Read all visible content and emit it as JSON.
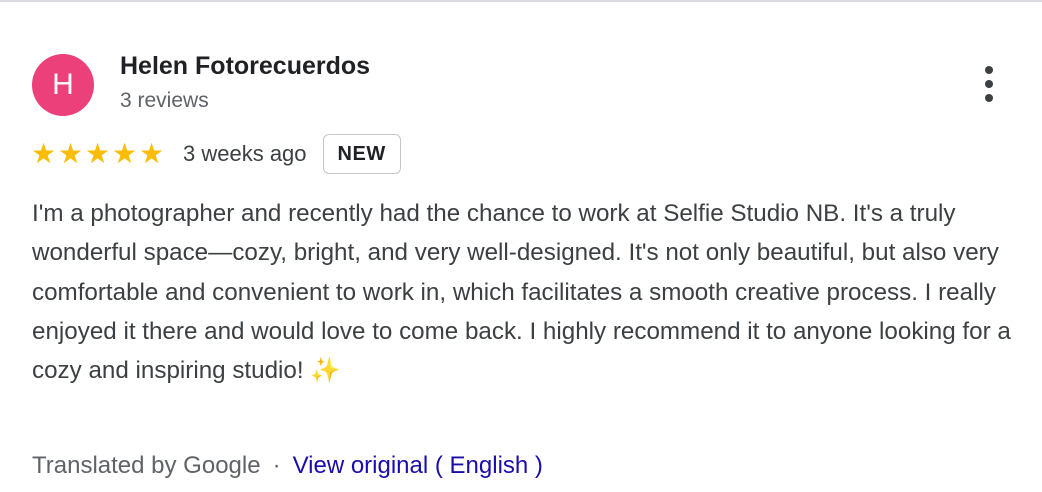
{
  "review": {
    "author_initial": "H",
    "author_name": "Helen Fotorecuerdos",
    "author_reviews": "3 reviews",
    "rating": 5,
    "rating_max": 5,
    "star_glyph": "★",
    "date": "3 weeks ago",
    "badge": "NEW",
    "text": "I'm a photographer and recently had the chance to work at Selfie Studio NB. It's a truly wonderful space—cozy, bright, and very well-designed. It's not only beautiful, but also very comfortable and convenient to work in, which facilitates a smooth creative process. I really enjoyed it there and would love to come back. I highly recommend it to anyone looking for a cozy and inspiring studio!",
    "emoji": "✨",
    "translated_by": "Translated by Google",
    "separator": "·",
    "view_original": "View original ( English )"
  },
  "colors": {
    "avatar_bg": "#ec407a",
    "star": "#fbbc04",
    "link": "#1a0dab"
  },
  "icons": {
    "more": "more-vert-icon",
    "star": "star-icon",
    "sparkle": "sparkles-icon"
  }
}
